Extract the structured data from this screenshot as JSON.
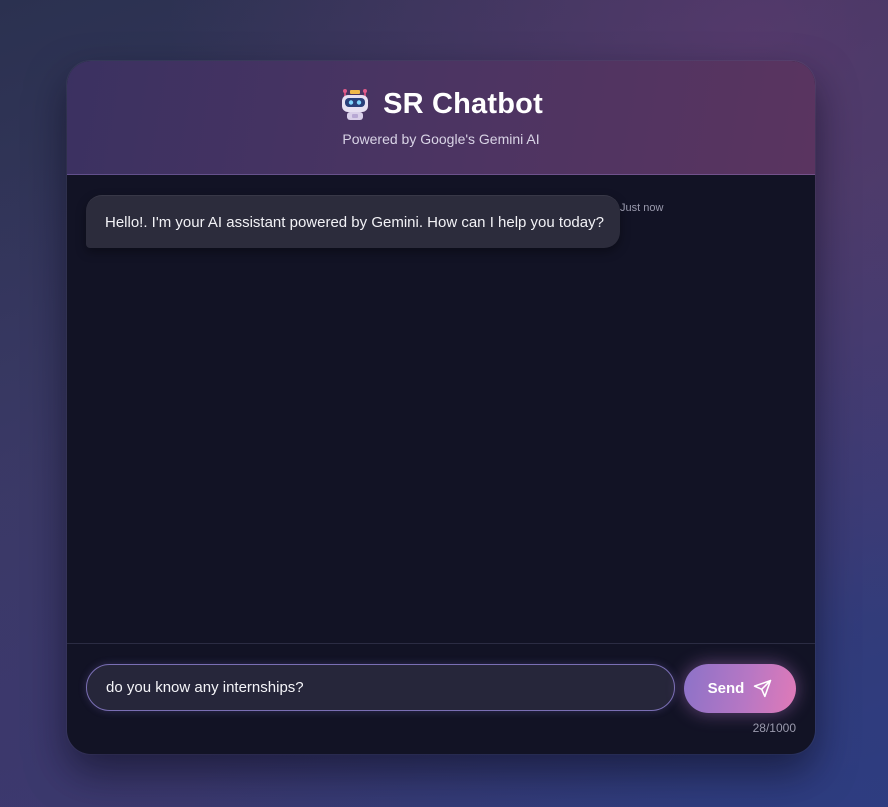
{
  "header": {
    "icon": "robot-icon",
    "title": "SR Chatbot",
    "subtitle": "Powered by Google's Gemini AI"
  },
  "messages": [
    {
      "sender": "bot",
      "text": "Hello!. I'm your AI assistant powered by Gemini. How can I help you today?",
      "timestamp": "Just now"
    }
  ],
  "input": {
    "value": "do you know any internships?",
    "char_count": "28/1000"
  },
  "send_button": {
    "label": "Send",
    "icon": "send-icon"
  },
  "colors": {
    "accent_start": "#8c72c8",
    "accent_end": "#e07ab8",
    "panel_bg": "#121325",
    "bubble_bg": "#2c2c3c"
  }
}
